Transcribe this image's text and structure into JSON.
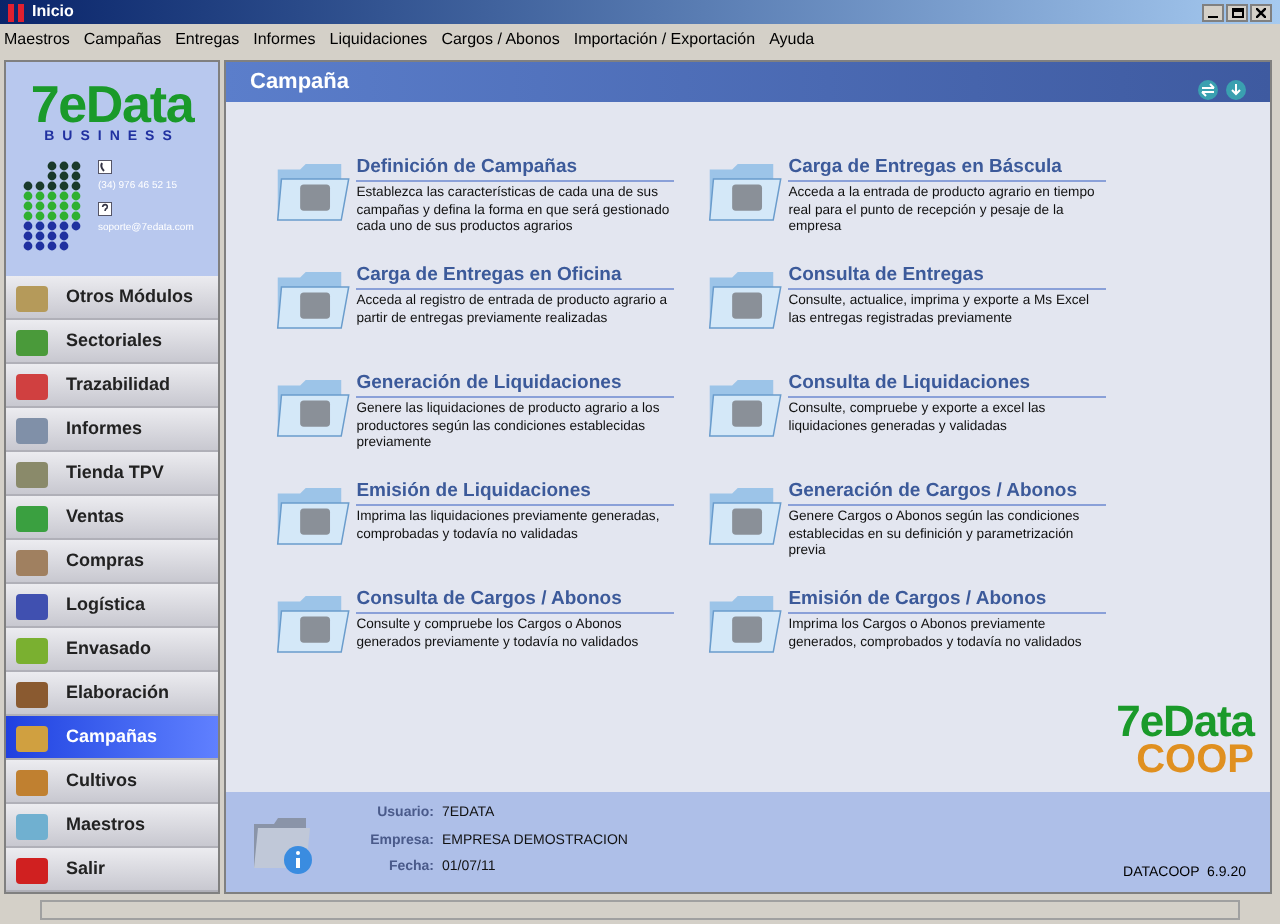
{
  "window": {
    "title": "Inicio"
  },
  "menu": [
    "Maestros",
    "Campañas",
    "Entregas",
    "Informes",
    "Liquidaciones",
    "Cargos / Abonos",
    "Importación / Exportación",
    "Ayuda"
  ],
  "brand": {
    "logo_main": "7eData",
    "logo_sub": "BUSINESS",
    "phone": "(34) 976 46 52 15",
    "email": "soporte@7edata.com"
  },
  "sidebar": {
    "items": [
      {
        "label": "Otros Módulos",
        "selected": false,
        "color": "#b59a5a"
      },
      {
        "label": "Sectoriales",
        "selected": false,
        "color": "#4a9a3a"
      },
      {
        "label": "Trazabilidad",
        "selected": false,
        "color": "#d04040"
      },
      {
        "label": "Informes",
        "selected": false,
        "color": "#8090a8"
      },
      {
        "label": "Tienda TPV",
        "selected": false,
        "color": "#8a8a6a"
      },
      {
        "label": "Ventas",
        "selected": false,
        "color": "#3aa040"
      },
      {
        "label": "Compras",
        "selected": false,
        "color": "#a08060"
      },
      {
        "label": "Logística",
        "selected": false,
        "color": "#4050b0"
      },
      {
        "label": "Envasado",
        "selected": false,
        "color": "#7ab030"
      },
      {
        "label": "Elaboración",
        "selected": false,
        "color": "#8a5a30"
      },
      {
        "label": "Campañas",
        "selected": true,
        "color": "#d0a040"
      },
      {
        "label": "Cultivos",
        "selected": false,
        "color": "#c08030"
      },
      {
        "label": "Maestros",
        "selected": false,
        "color": "#70b0d0"
      },
      {
        "label": "Salir",
        "selected": false,
        "color": "#d02020"
      }
    ]
  },
  "header": {
    "title": "Campaña"
  },
  "options": [
    {
      "title": "Definición de Campañas",
      "description": "Establezca las características de cada una de sus campañas y defina la forma en que será gestionado cada uno de sus productos agrarios"
    },
    {
      "title": "Carga de Entregas en Báscula",
      "description": "Acceda a la entrada de producto agrario en tiempo real para el punto de recepción y pesaje de la empresa"
    },
    {
      "title": "Carga de Entregas en Oficina",
      "description": "Acceda al registro de entrada de producto agrario a partir de entregas previamente realizadas"
    },
    {
      "title": "Consulta de Entregas",
      "description": "Consulte, actualice, imprima y exporte a Ms Excel las entregas registradas previamente"
    },
    {
      "title": "Generación de Liquidaciones",
      "description": "Genere las liquidaciones de producto agrario a los productores según las condiciones establecidas previamente"
    },
    {
      "title": "Consulta de Liquidaciones",
      "description": "Consulte, compruebe y exporte a excel las liquidaciones generadas y validadas"
    },
    {
      "title": "Emisión de Liquidaciones",
      "description": "Imprima las liquidaciones previamente generadas, comprobadas y todavía no validadas"
    },
    {
      "title": "Generación de Cargos / Abonos",
      "description": "Genere Cargos o Abonos según las condiciones establecidas en su definición y parametrización previa"
    },
    {
      "title": "Consulta de Cargos / Abonos",
      "description": "Consulte y compruebe los Cargos o Abonos generados previamente y todavía no validados"
    },
    {
      "title": "Emisión de Cargos / Abonos",
      "description": "Imprima los Cargos o Abonos previamente generados, comprobados y todavía no validados"
    }
  ],
  "product_logo": {
    "main": "7eData",
    "sub": "COOP"
  },
  "footer": {
    "fields": [
      {
        "label": "Usuario:",
        "value": "7EDATA"
      },
      {
        "label": "Empresa:",
        "value": "EMPRESA DEMOSTRACION"
      },
      {
        "label": "Fecha:",
        "value": "01/07/11"
      }
    ],
    "version": "DATACOOP  6.9.20"
  }
}
